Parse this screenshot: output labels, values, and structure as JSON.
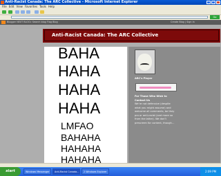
{
  "window": {
    "title": "Anti-Racist Canada: The ARC Collective - Microsoft Internet Explorer"
  },
  "menu": [
    "File",
    "Edit",
    "View",
    "Favorites",
    "Tools",
    "Help"
  ],
  "blogger_bar": {
    "left": "Blogger  NEXT BLOG»  Search blog  Flag Blog",
    "right": "Create Blog | Sign In"
  },
  "address": {
    "go_label": "Go"
  },
  "header": {
    "blog_title": "Anti-Racist Canada: The ARC Collective"
  },
  "post": {
    "lines": [
      "BAHA",
      "HAHA",
      "HAHA",
      "HAHA",
      "LMFAO",
      "BAHAHA",
      "HAHAHA",
      "HAHAHA"
    ]
  },
  "sidebar": {
    "heading": "ARC's Player",
    "section_title": "For Those Who Wish to Contact Us",
    "body": "We’re not defensive (despite what you might assume) and welcome all comments, be they pro or anti-racist (and more so from the latter). We don’t prescreen for content, though…"
  },
  "taskbar": {
    "start_label": "start",
    "tasks": [
      "Windows Messenger",
      "Anti-Racist Canada...",
      "2 Windows Explorer"
    ],
    "clock": "2:09 PM"
  }
}
